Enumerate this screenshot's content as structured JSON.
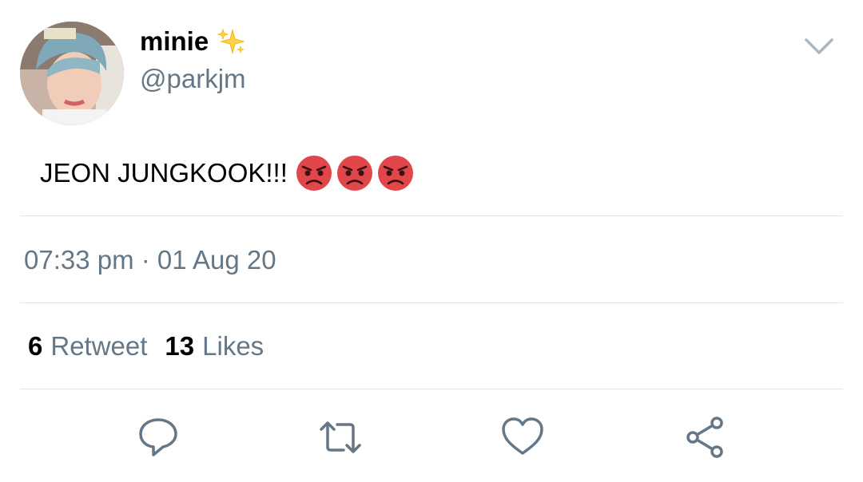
{
  "tweet": {
    "display_name": "minie",
    "handle": "@parkjm",
    "text": "JEON JUNGKOOK!!!",
    "emojis": [
      "angry-face",
      "angry-face",
      "angry-face"
    ],
    "timestamp": "07:33 pm · 01 Aug 20",
    "retweet_count": "6",
    "retweet_label": "Retweet",
    "like_count": "13",
    "like_label": "Likes"
  },
  "actions": [
    "reply",
    "retweet",
    "like",
    "share"
  ],
  "colors": {
    "text": "#000000",
    "secondary": "#657786",
    "divider": "#dfe3e6",
    "sparkle": "#f5c518",
    "emoji_red": "#e1474a"
  }
}
